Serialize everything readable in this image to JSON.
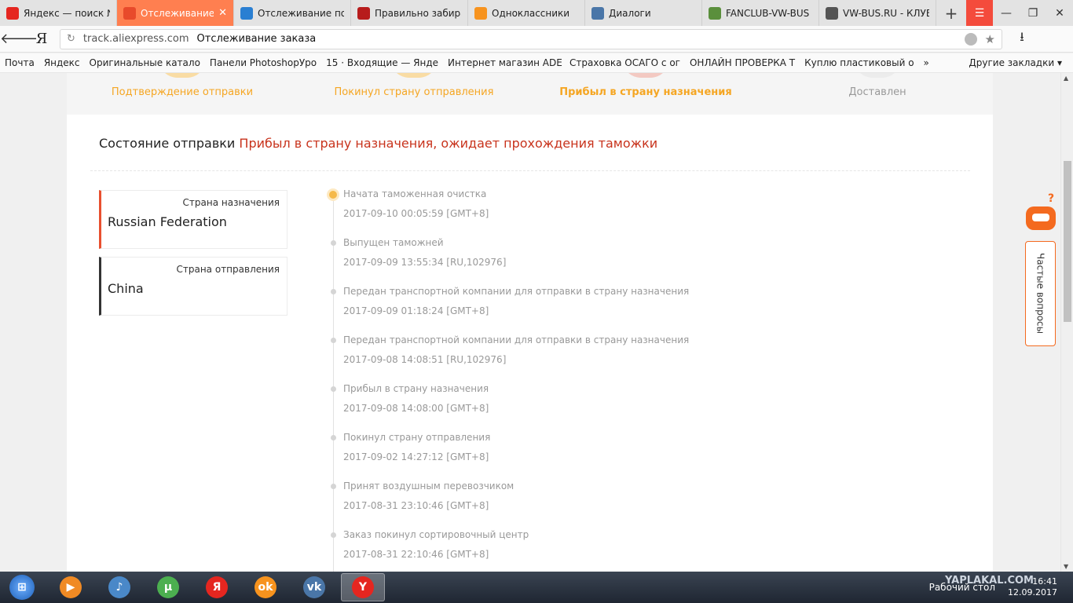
{
  "tabs": [
    {
      "label": "Яндекс — поиск №",
      "icon": "yandex-icon",
      "color": "#e52620"
    },
    {
      "label": "Отслеживание з",
      "icon": "aliexpress-icon",
      "color": "#e84a2b",
      "active": true
    },
    {
      "label": "Отслеживание поч",
      "icon": "tracking24-icon",
      "color": "#2a7fd2"
    },
    {
      "label": "Правильно забира",
      "icon": "yaplakal-icon",
      "color": "#b71c1c"
    },
    {
      "label": "Одноклассники",
      "icon": "odnoklassniki-icon",
      "color": "#f7931e"
    },
    {
      "label": "Диалоги",
      "icon": "dialogs-icon",
      "color": "#4a76a8"
    },
    {
      "label": "FANCLUB-VW-BUS",
      "icon": "fanclub-icon",
      "color": "#5a8f3c"
    },
    {
      "label": "VW-BUS.RU - КЛУБ",
      "icon": "vw-icon",
      "color": "#555555"
    }
  ],
  "address": {
    "brand": "Я",
    "domain": "track.aliexpress.com",
    "title": "Отслеживание заказа"
  },
  "bookmarks": [
    "Почта",
    "Яндекс",
    "Оригинальные катало",
    "Панели PhotoshopУро",
    "15 · Входящие — Янде",
    "Интернет магазин ADE",
    "Страховка ОСАГО с ог",
    "ОНЛАЙН ПРОВЕРКА Т",
    "Куплю пластиковый о"
  ],
  "bookmarks_more": "»",
  "bookmarks_other": "Другие закладки ▾",
  "steps": [
    {
      "label": "Подтверждение отправки",
      "state": "done"
    },
    {
      "label": "Покинул страну отправления",
      "state": "done"
    },
    {
      "label": "Прибыл в страну назначения",
      "state": "current"
    },
    {
      "label": "Доставлен",
      "state": "pending"
    }
  ],
  "status": {
    "label": "Состояние отправки",
    "value": "Прибыл в страну назначения, ожидает прохождения таможки"
  },
  "destination": {
    "label": "Страна назначения",
    "value": "Russian Federation"
  },
  "origin": {
    "label": "Страна отправления",
    "value": "China"
  },
  "events": [
    {
      "title": "Начата таможенная очистка",
      "date": "2017-09-10 00:05:59 [GMT+8]"
    },
    {
      "title": "Выпущен таможней",
      "date": "2017-09-09 13:55:34 [RU,102976]"
    },
    {
      "title": "Передан транспортной компании для отправки в страну назначения",
      "date": "2017-09-09 01:18:24 [GMT+8]"
    },
    {
      "title": "Передан транспортной компании для отправки в страну назначения",
      "date": "2017-09-08 14:08:51 [RU,102976]"
    },
    {
      "title": "Прибыл в страну назначения",
      "date": "2017-09-08 14:08:00 [GMT+8]"
    },
    {
      "title": "Покинул страну отправления",
      "date": "2017-09-02 14:27:12 [GMT+8]"
    },
    {
      "title": "Принят воздушным перевозчиком",
      "date": "2017-08-31 23:10:46 [GMT+8]"
    },
    {
      "title": "Заказ покинул сортировочный центр",
      "date": "2017-08-31 22:10:46 [GMT+8]"
    }
  ],
  "faq": {
    "label": "Частые вопросы",
    "mark": "?"
  },
  "colors": {
    "accent": "#f5a623",
    "status_value": "#c8331c",
    "step_done": "#f5a623",
    "step_current": "#f5a623",
    "step_pending": "#999999",
    "destination_border": "#e8502f",
    "origin_border": "#333333"
  },
  "taskbar": {
    "apps": [
      {
        "name": "media-player-icon",
        "color": "#f08a24",
        "glyph": "▶"
      },
      {
        "name": "speaker-icon",
        "color": "#4a88c8",
        "glyph": "♪"
      },
      {
        "name": "utorrent-icon",
        "color": "#4caf50",
        "glyph": "µ"
      },
      {
        "name": "yandex-taskbar-icon",
        "color": "#e52620",
        "glyph": "Я"
      },
      {
        "name": "odnoklassniki-taskbar-icon",
        "color": "#f7931e",
        "glyph": "ok"
      },
      {
        "name": "vk-icon",
        "color": "#4a76a8",
        "glyph": "vk"
      },
      {
        "name": "yandex-browser-icon",
        "color": "#e52620",
        "glyph": "Y",
        "active": true
      }
    ],
    "desktop": "Рабочий стол",
    "time": "16:41",
    "date": "12.09.2017",
    "watermark": "YAPLAKAL.COM"
  }
}
